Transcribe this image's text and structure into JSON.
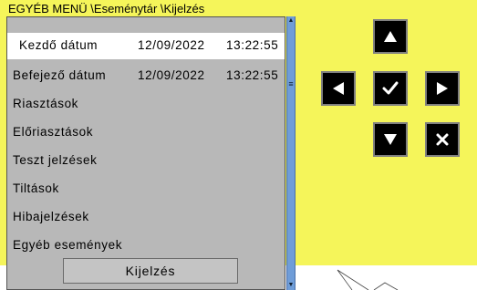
{
  "breadcrumb": "EGYÉB MENÜ \\Eseménytár \\Kijelzés",
  "menu": {
    "rows": [
      {
        "label": "Kezdő dátum",
        "date": "12/09/2022",
        "time": "13:22:55"
      },
      {
        "label": "Befejező dátum",
        "date": "12/09/2022",
        "time": "13:22:55"
      },
      {
        "label": "Riasztások"
      },
      {
        "label": "Előriasztások"
      },
      {
        "label": "Teszt jelzések"
      },
      {
        "label": "Tiltások"
      },
      {
        "label": "Hibajelzések"
      },
      {
        "label": "Egyéb események"
      }
    ],
    "selected_index": 0,
    "action_label": "Kijelzés"
  },
  "scrollbar": {
    "up_icon": "scroll-up-arrow-icon",
    "down_icon": "scroll-down-arrow-icon",
    "grip_icon": "scroll-grip-icon"
  },
  "nav_pad": {
    "buttons": [
      "up-arrow-icon",
      "left-arrow-icon",
      "checkmark-icon",
      "right-arrow-icon",
      "down-arrow-icon",
      "cancel-x-icon"
    ]
  },
  "colors": {
    "panel_background": "#f5f55a",
    "menu_background": "#b8b8b8",
    "selected_row": "#ffffff",
    "scrollbar": "#6f9dd8",
    "nav_button": "#000000",
    "nav_button_border": "#808080"
  }
}
